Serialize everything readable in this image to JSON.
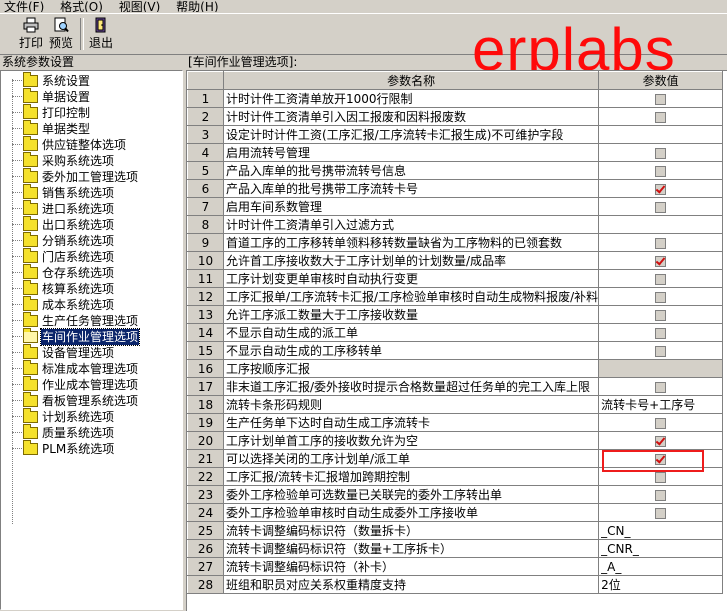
{
  "menu": [
    {
      "label": "文件(F)"
    },
    {
      "label": "格式(O)"
    },
    {
      "label": "视图(V)"
    },
    {
      "label": "帮助(H)"
    }
  ],
  "toolbar": {
    "print_label": "打印",
    "preview_label": "预览",
    "exit_label": "退出"
  },
  "left_panel": {
    "title": "系统参数设置",
    "items": [
      {
        "label": "系统设置"
      },
      {
        "label": "单据设置"
      },
      {
        "label": "打印控制"
      },
      {
        "label": "单据类型"
      },
      {
        "label": "供应链整体选项"
      },
      {
        "label": "采购系统选项"
      },
      {
        "label": "委外加工管理选项"
      },
      {
        "label": "销售系统选项"
      },
      {
        "label": "进口系统选项"
      },
      {
        "label": "出口系统选项"
      },
      {
        "label": "分销系统选项"
      },
      {
        "label": "门店系统选项"
      },
      {
        "label": "仓存系统选项"
      },
      {
        "label": "核算系统选项"
      },
      {
        "label": "成本系统选项"
      },
      {
        "label": "生产任务管理选项"
      },
      {
        "label": "车间作业管理选项"
      },
      {
        "label": "设备管理选项"
      },
      {
        "label": "标准成本管理选项"
      },
      {
        "label": "作业成本管理选项"
      },
      {
        "label": "看板管理系统选项"
      },
      {
        "label": "计划系统选项"
      },
      {
        "label": "质量系统选项"
      },
      {
        "label": "PLM系统选项"
      }
    ],
    "selected_index": 16
  },
  "right_panel": {
    "title": "[车间作业管理选项]:",
    "columns": {
      "name": "参数名称",
      "value": "参数值"
    },
    "rows": [
      {
        "num": "1",
        "name": "计时计件工资清单放开1000行限制",
        "type": "checkbox",
        "checked": false
      },
      {
        "num": "2",
        "name": "计时计件工资清单引入因工报废和因料报废数",
        "type": "checkbox",
        "checked": false
      },
      {
        "num": "3",
        "name": "设定计时计件工资(工序汇报/工序流转卡汇报生成)不可维护字段",
        "type": "text",
        "value": ""
      },
      {
        "num": "4",
        "name": "启用流转号管理",
        "type": "checkbox",
        "checked": false
      },
      {
        "num": "5",
        "name": "产品入库单的批号携带流转号信息",
        "type": "checkbox",
        "checked": false
      },
      {
        "num": "6",
        "name": "产品入库单的批号携带工序流转卡号",
        "type": "checkbox",
        "checked": true
      },
      {
        "num": "7",
        "name": "启用车间系数管理",
        "type": "checkbox",
        "checked": false
      },
      {
        "num": "8",
        "name": "计时计件工资清单引入过滤方式",
        "type": "text",
        "value": ""
      },
      {
        "num": "9",
        "name": "首道工序的工序移转单领料移转数量缺省为工序物料的已领套数",
        "type": "checkbox",
        "checked": false
      },
      {
        "num": "10",
        "name": "允许首工序接收数大于工序计划单的计划数量/成品率",
        "type": "checkbox",
        "checked": true
      },
      {
        "num": "11",
        "name": "工序计划变更单审核时自动执行变更",
        "type": "checkbox",
        "checked": false
      },
      {
        "num": "12",
        "name": "工序汇报单/工序流转卡汇报/工序检验单审核时自动生成物料报废/补料",
        "type": "checkbox",
        "checked": false
      },
      {
        "num": "13",
        "name": "允许工序派工数量大于工序接收数量",
        "type": "checkbox",
        "checked": false
      },
      {
        "num": "14",
        "name": "不显示自动生成的派工单",
        "type": "checkbox",
        "checked": false
      },
      {
        "num": "15",
        "name": "不显示自动生成的工序移转单",
        "type": "checkbox",
        "checked": false
      },
      {
        "num": "16",
        "name": "工序按顺序汇报",
        "type": "filled",
        "value": ""
      },
      {
        "num": "17",
        "name": "非末道工序汇报/委外接收时提示合格数量超过任务单的完工入库上限",
        "type": "checkbox",
        "checked": false
      },
      {
        "num": "18",
        "name": "流转卡条形码规则",
        "type": "text",
        "value": "流转卡号+工序号"
      },
      {
        "num": "19",
        "name": "生产任务单下达时自动生成工序流转卡",
        "type": "checkbox",
        "checked": false
      },
      {
        "num": "20",
        "name": "工序计划单首工序的接收数允许为空",
        "type": "checkbox",
        "checked": true
      },
      {
        "num": "21",
        "name": "可以选择关闭的工序计划单/派工单",
        "type": "checkbox",
        "checked": true
      },
      {
        "num": "22",
        "name": "工序汇报/流转卡汇报增加跨期控制",
        "type": "checkbox",
        "checked": false
      },
      {
        "num": "23",
        "name": "委外工序检验单可选数量已关联完的委外工序转出单",
        "type": "checkbox",
        "checked": false
      },
      {
        "num": "24",
        "name": "委外工序检验单审核时自动生成委外工序接收单",
        "type": "checkbox",
        "checked": false
      },
      {
        "num": "25",
        "name": "流转卡调整编码标识符（数量拆卡）",
        "type": "text",
        "value": "_CN_"
      },
      {
        "num": "26",
        "name": "流转卡调整编码标识符（数量+工序拆卡）",
        "type": "text",
        "value": "_CNR_"
      },
      {
        "num": "27",
        "name": "流转卡调整编码标识符（补卡）",
        "type": "text",
        "value": "_A_"
      },
      {
        "num": "28",
        "name": "班组和职员对应关系权重精度支持",
        "type": "text",
        "value": "2位"
      }
    ]
  },
  "watermark": "erplabs",
  "colors": {
    "selection": "#0a246a",
    "check": "#d01010",
    "highlight_box": "#ee1c1c",
    "watermark": "#ff0a0a"
  }
}
